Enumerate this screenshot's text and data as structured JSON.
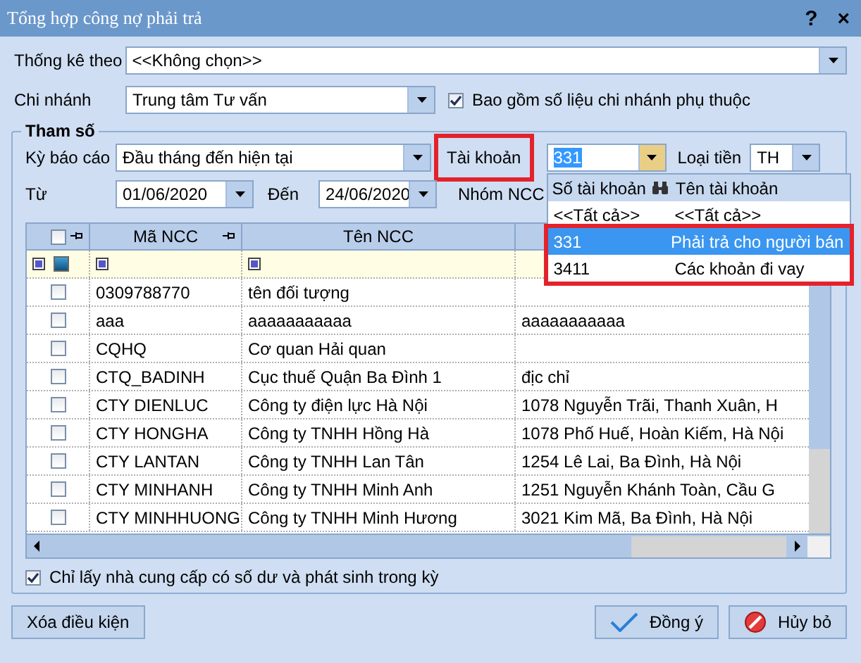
{
  "window": {
    "title": "Tổng hợp công nợ phải trả",
    "help": "?",
    "close": "×"
  },
  "statistic_by": {
    "label": "Thống kê theo",
    "value": "<<Không chọn>>"
  },
  "branch": {
    "label": "Chi nhánh",
    "value": "Trung tâm Tư vấn"
  },
  "include_dependent": {
    "label": "Bao gồm số liệu chi nhánh phụ thuộc",
    "checked": true
  },
  "params": {
    "title": "Tham số",
    "period": {
      "label": "Kỳ báo cáo",
      "value": "Đầu tháng đến hiện tại"
    },
    "account": {
      "label": "Tài khoản",
      "value": "331",
      "highlighted": true
    },
    "currency": {
      "label": "Loại tiền",
      "value": "TH"
    },
    "from": {
      "label": "Từ",
      "value": "01/06/2020"
    },
    "to": {
      "label": "Đến",
      "value": "24/06/2020"
    },
    "supplier_group": {
      "label": "Nhóm NCC"
    }
  },
  "grid": {
    "header_checked": false,
    "columns": [
      "Mã NCC",
      "Tên NCC"
    ],
    "rows": [
      {
        "checked": false,
        "code": "0309788770",
        "name": "tên đối tượng"
      },
      {
        "checked": false,
        "code": "aaa",
        "name": "aaaaaaaaaaa",
        "column_3": "aaaaaaaaaaa"
      },
      {
        "checked": false,
        "code": "CQHQ",
        "name": "Cơ quan Hải quan"
      },
      {
        "checked": false,
        "code": "CTQ_BADINH",
        "name": "Cục thuế Quận Ba Đình 1",
        "column_3": "địc chỉ"
      },
      {
        "checked": false,
        "code": "CTY DIENLUC",
        "name": "Công ty điện lực Hà Nội",
        "column_3": "1078 Nguyễn Trãi, Thanh Xuân, H"
      },
      {
        "checked": false,
        "code": "CTY HONGHA",
        "name": "Công ty TNHH Hồng Hà",
        "column_3": "1078 Phố Huế, Hoàn Kiếm, Hà Nội"
      },
      {
        "checked": false,
        "code": "CTY LANTAN",
        "name": "Công ty TNHH Lan Tân",
        "column_3": "1254 Lê Lai, Ba Đình, Hà Nội"
      },
      {
        "checked": false,
        "code": "CTY MINHANH",
        "name": "Công ty TNHH Minh Anh",
        "column_3": "1251 Nguyễn Khánh Toàn, Cầu G"
      },
      {
        "checked": false,
        "code": "CTY MINHHUONG",
        "name": "Công ty TNHH Minh Hương",
        "column_3": "3021 Kim Mã, Ba Đình, Hà Nội"
      }
    ]
  },
  "account_dropdown": {
    "columns": [
      "Số tài khoản",
      "Tên tài khoản"
    ],
    "highlighted": true,
    "all_row": [
      "<<Tất cả>>",
      "<<Tất cả>>"
    ],
    "items": [
      {
        "number": "331",
        "name": "Phải trả cho người bán",
        "selected": true
      },
      {
        "number": "3411",
        "name": "Các khoản đi vay",
        "selected": false
      }
    ]
  },
  "only_with_balance": {
    "label": "Chỉ lấy nhà cung cấp có số dư và phát sinh trong kỳ",
    "checked": true
  },
  "buttons": {
    "clear": "Xóa điều kiện",
    "ok": "Đồng ý",
    "cancel": "Hủy bỏ"
  }
}
